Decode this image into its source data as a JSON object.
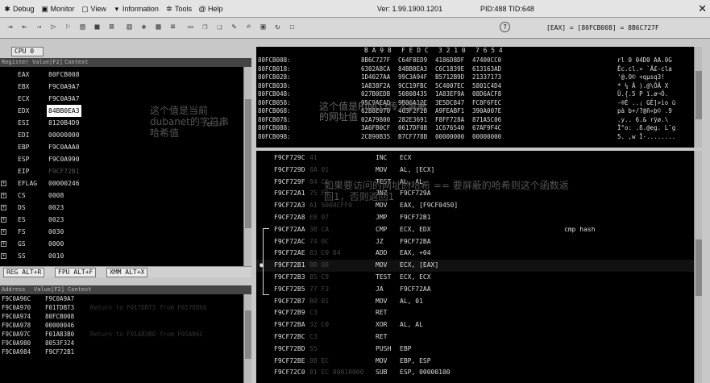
{
  "menu": {
    "debug": "Debug",
    "monitor": "Monitor",
    "view": "View",
    "information": "Information",
    "tools": "Tools",
    "help": "Help",
    "version": "Ver: 1.99.1900.1201",
    "pid": "PID:488 TID:648",
    "close": "✕"
  },
  "toolbar": {
    "expr": "[EAX] = [80FCB008] = 8B6C727F",
    "help": "?"
  },
  "cpu_tab": "CPU 0",
  "reg_header": {
    "register": "Register",
    "value": "Value[F2]",
    "context": "Context"
  },
  "registers": [
    {
      "name": "EAX",
      "value": "80FCB008"
    },
    {
      "name": "EBX",
      "value": "F9C0A9A7"
    },
    {
      "name": "ECX",
      "value": "F9C0A9A7"
    },
    {
      "name": "EDX",
      "value": "84BB0EA3"
    },
    {
      "name": "ESI",
      "value": "8120B4D9"
    },
    {
      "name": "EDI",
      "value": "00000000"
    },
    {
      "name": "EBP",
      "value": "F9C0AAA0"
    },
    {
      "name": "ESP",
      "value": "F9C0A990"
    },
    {
      "name": "EIP",
      "value": "F9CF72B1"
    },
    {
      "name": "EFLAG",
      "value": "00000246"
    },
    {
      "name": "CS",
      "value": "0008"
    },
    {
      "name": "DS",
      "value": "0023"
    },
    {
      "name": "ES",
      "value": "0023"
    },
    {
      "name": "FS",
      "value": "0030"
    },
    {
      "name": "GS",
      "value": "0000"
    },
    {
      "name": "SS",
      "value": "0010"
    }
  ],
  "reg_note": "这个值是当前dubanet的字符串哈希值",
  "reg_tabs": {
    "reg": "REG ALT+R",
    "fpu": "FPU ALT+F",
    "xmm": "XMM ALT+X"
  },
  "stack_header": {
    "address": "Address",
    "value": "Value[F2]",
    "context": "Context"
  },
  "stack": [
    {
      "addr": "F9C0A96C",
      "val": "F9C0A9A7",
      "ctx": ""
    },
    {
      "addr": "F9C0A970",
      "val": "F01TDBT3",
      "ctx": "Return to F017DBT3 from F017D866"
    },
    {
      "addr": "F9C0A974",
      "val": "80FCB008",
      "ctx": ""
    },
    {
      "addr": "F9C0A978",
      "val": "00000046",
      "ctx": ""
    },
    {
      "addr": "F9C0A97C",
      "val": "F01AB3B0",
      "ctx": "Return to F01AB3B0 from F01AB6C"
    },
    {
      "addr": "F9C0A980",
      "val": "8053F324",
      "ctx": ""
    },
    {
      "addr": "F9C0A984",
      "val": "F9CF72B1",
      "ctx": ""
    }
  ],
  "mem_header": {
    "a": "B A 9 8",
    "b": "F E D C",
    "c": "3 2 1 0",
    "d": "7 6 5 4"
  },
  "memory": [
    {
      "addr": "80FCB008:",
      "c1": "8B6C727F",
      "c2": "C64F8ED9",
      "c3": "4186D8DF",
      "c4": "47400CC0",
      "ascii": "rl 0 04D0 AA.0G"
    },
    {
      "addr": "80FCB018:",
      "c1": "6302A8CA",
      "c2": "84BB0EA3",
      "c3": "C6C1839E",
      "c4": "613163AD",
      "ascii": "Êc.cl.» `Ä£-cla"
    },
    {
      "addr": "80FCB028:",
      "c1": "1D4027AA",
      "c2": "99C3A94F",
      "c3": "B5712B9D",
      "c4": "21337173",
      "ascii": "'@.O© +qµsq3!"
    },
    {
      "addr": "80FCB038:",
      "c1": "1A838F2A",
      "c2": "9CC19FBC",
      "c3": "5C4007EC",
      "c4": "5801C4D4",
      "ascii": "* ¼ Ä ).@\\ÔÄ X"
    },
    {
      "addr": "80FCB048:",
      "c1": "027B0EDB",
      "c2": "50808435",
      "c3": "1A83EF9A",
      "c4": "08D6ACF8",
      "ascii": "Û.{.5 P ï.ø¬Ö."
    },
    {
      "addr": "80FCB058:",
      "c1": "95C9AEAD",
      "c2": "9B06A12E",
      "c3": "3E5DC847",
      "c4": "FC8F6FEC",
      "ascii": "-®É ..¡ GÈ]>ìo ü"
    },
    {
      "addr": "80FCB068:",
      "c1": "62B8E070",
      "c2": "403F2F2B",
      "c3": "A9FEABF1",
      "c4": "390A007E",
      "ascii": "pà b+/?@ñ«þ© .9"
    },
    {
      "addr": "80FCB078:",
      "c1": "02A79800",
      "c2": "282E3691",
      "c3": "F8FF728A",
      "c4": "871A5C06",
      "ascii": ".y.. 6.& rÿø.\\ "
    },
    {
      "addr": "80FCB088:",
      "c1": "3A6FB0CF",
      "c2": "0617DF0B",
      "c3": "1C676540",
      "c4": "67AF9F4C",
      "ascii": "Ï°o: .ß.@eg. L¯g"
    },
    {
      "addr": "80FCB098:",
      "c1": "2C890B35",
      "c2": "B7CF778B",
      "c3": "00000000",
      "c4": "00000000",
      "ascii": "5. ,w Ï·........"
    }
  ],
  "mem_note": "这个值是RING3传入屏蔽的网址值",
  "disasm": [
    {
      "addr": "F9CF729C",
      "bytes": "41",
      "mn": "INC",
      "op": "ECX",
      "cmt": ""
    },
    {
      "addr": "F9CF729D",
      "bytes": "8A 01",
      "mn": "MOV",
      "op": "AL, [ECX]",
      "cmt": ""
    },
    {
      "addr": "F9CF729F",
      "bytes": "84 C0",
      "mn": "TEST",
      "op": "AL, AL",
      "cmt": ""
    },
    {
      "addr": "F9CF72A1",
      "bytes": "75 F9",
      "mn": "JNZ",
      "op": "F9CF729A",
      "cmt": ""
    },
    {
      "addr": "F9CF72A3",
      "bytes": "A1 5004CFF9",
      "mn": "MOV",
      "op": "EAX, [F9CF0450]",
      "cmt": ""
    },
    {
      "addr": "F9CF72A8",
      "bytes": "EB 07",
      "mn": "JMP",
      "op": "F9CF72B1",
      "cmt": ""
    },
    {
      "addr": "F9CF72AA",
      "bytes": "3B CA",
      "mn": "CMP",
      "op": "ECX, EDX",
      "cmt": "cmp hash"
    },
    {
      "addr": "F9CF72AC",
      "bytes": "74 0C",
      "mn": "JZ",
      "op": "F9CF72BA",
      "cmt": ""
    },
    {
      "addr": "F9CF72AE",
      "bytes": "83 C0 04",
      "mn": "ADD",
      "op": "EAX, +04",
      "cmt": ""
    },
    {
      "addr": "F9CF72B1",
      "bytes": "8B 08",
      "mn": "MOV",
      "op": "ECX, [EAX]",
      "cmt": ""
    },
    {
      "addr": "F9CF72B3",
      "bytes": "85 C9",
      "mn": "TEST",
      "op": "ECX, ECX",
      "cmt": ""
    },
    {
      "addr": "F9CF72B5",
      "bytes": "77 F3",
      "mn": "JA",
      "op": "F9CF72AA",
      "cmt": ""
    },
    {
      "addr": "F9CF72B7",
      "bytes": "B0 01",
      "mn": "MOV",
      "op": "AL, 01",
      "cmt": ""
    },
    {
      "addr": "F9CF72B9",
      "bytes": "C3",
      "mn": "RET",
      "op": "",
      "cmt": ""
    },
    {
      "addr": "F9CF72BA",
      "bytes": "32 C0",
      "mn": "XOR",
      "op": "AL, AL",
      "cmt": ""
    },
    {
      "addr": "F9CF72BC",
      "bytes": "C3",
      "mn": "RET",
      "op": "",
      "cmt": ""
    },
    {
      "addr": "F9CF72BD",
      "bytes": "55",
      "mn": "PUSH",
      "op": "EBP",
      "cmt": ""
    },
    {
      "addr": "F9CF72BE",
      "bytes": "8B EC",
      "mn": "MOV",
      "op": "EBP, ESP",
      "cmt": ""
    },
    {
      "addr": "F9CF72C0",
      "bytes": "81 EC 00010000",
      "mn": "SUB",
      "op": "ESP, 00000100",
      "cmt": ""
    }
  ],
  "dis_note": "如果要访问的网址的哈希 == 要屏蔽的哈希则这个函数返回1，否则返回1"
}
